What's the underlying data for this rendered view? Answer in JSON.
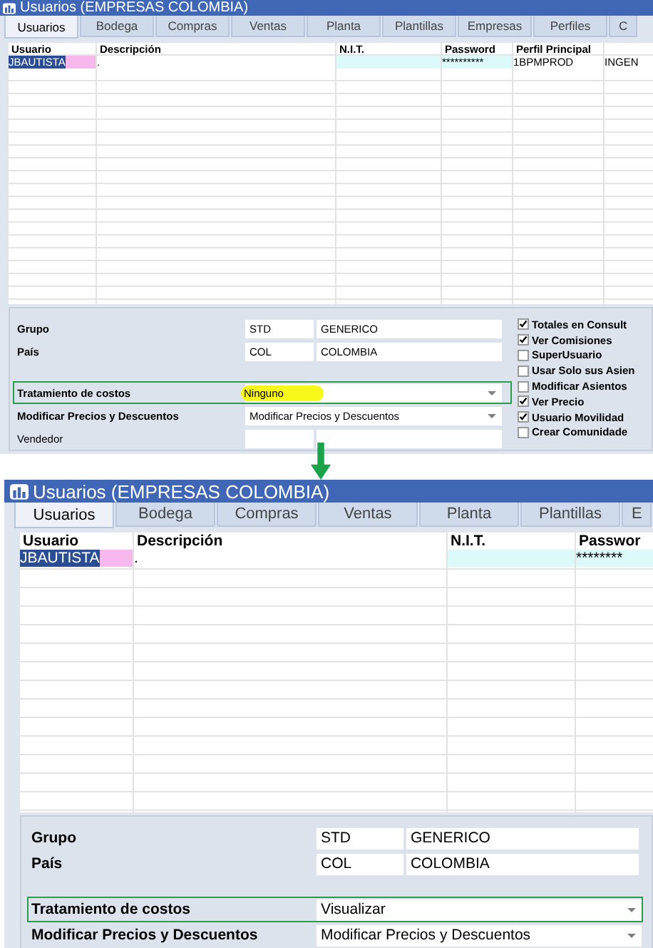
{
  "panels": [
    {
      "title": "Usuarios (EMPRESAS COLOMBIA)",
      "tabs": [
        {
          "label": "Usuarios",
          "selected": true
        },
        {
          "label": "Bodega",
          "selected": false
        },
        {
          "label": "Compras",
          "selected": false
        },
        {
          "label": "Ventas",
          "selected": false
        },
        {
          "label": "Planta",
          "selected": false
        },
        {
          "label": "Plantillas",
          "selected": false
        },
        {
          "label": "Empresas",
          "selected": false
        },
        {
          "label": "Perfiles",
          "selected": false
        },
        {
          "label": "C",
          "selected": false
        }
      ],
      "columns": [
        "Usuario",
        "Descripción",
        "N.I.T.",
        "Password",
        "Perfil Principal",
        null
      ],
      "rows": [
        {
          "selected": true,
          "cells": [
            "JBAUTISTA",
            ".",
            null,
            "**********",
            "1BPMPROD",
            "INGEN"
          ]
        }
      ],
      "form": {
        "field_groups": [
          [
            {
              "label": "Grupo",
              "bold": true,
              "kind": "pair",
              "values": [
                "STD",
                "GENERICO"
              ],
              "framed": false
            },
            {
              "label": "País",
              "bold": true,
              "kind": "pair",
              "values": [
                "COL",
                "COLOMBIA"
              ],
              "framed": false
            }
          ],
          [
            {
              "label": "Tratamiento de costos",
              "bold": true,
              "kind": "select",
              "value": "Ninguno",
              "highlighted": true,
              "framed": true
            },
            {
              "label": "Modificar Precios y Descuentos",
              "bold": true,
              "kind": "select",
              "value": "Modificar Precios y Descuentos",
              "highlighted": false,
              "framed": false
            },
            {
              "label": "Vendedor",
              "bold": false,
              "kind": "pair",
              "framed": false
            }
          ]
        ],
        "checkboxes": [
          {
            "label": "Totales en Consult",
            "checked": true
          },
          {
            "label": "Ver Comisiones",
            "checked": true
          },
          {
            "label": "SuperUsuario",
            "checked": false
          },
          {
            "label": "Usar Solo sus Asien",
            "checked": false
          },
          {
            "label": "Modificar Asientos",
            "checked": false
          },
          {
            "label": "Ver Precio",
            "checked": true
          },
          {
            "label": "Usuario Movilidad",
            "checked": true
          },
          {
            "label": "Crear Comunidade",
            "checked": false
          }
        ]
      }
    },
    {
      "title": "Usuarios (EMPRESAS COLOMBIA)",
      "tabs": [
        {
          "label": "Usuarios",
          "selected": true
        },
        {
          "label": "Bodega",
          "selected": false
        },
        {
          "label": "Compras",
          "selected": false
        },
        {
          "label": "Ventas",
          "selected": false
        },
        {
          "label": "Planta",
          "selected": false
        },
        {
          "label": "Plantillas",
          "selected": false
        },
        {
          "label": "E",
          "selected": false
        }
      ],
      "columns": [
        "Usuario",
        "Descripción",
        "N.I.T.",
        "Passwor"
      ],
      "rows": [
        {
          "selected": true,
          "cells": [
            "JBAUTISTA",
            ".",
            null,
            "********"
          ]
        }
      ],
      "form": {
        "field_groups": [
          [
            {
              "label": "Grupo",
              "bold": true,
              "kind": "pair",
              "values": [
                "STD",
                "GENERICO"
              ],
              "framed": false
            },
            {
              "label": "País",
              "bold": true,
              "kind": "pair",
              "values": [
                "COL",
                "COLOMBIA"
              ],
              "framed": false
            }
          ],
          [
            {
              "label": "Tratamiento de costos",
              "bold": true,
              "kind": "select",
              "value": "Visualizar",
              "highlighted": false,
              "framed": true
            },
            {
              "label": "Modificar Precios y Descuentos",
              "bold": true,
              "kind": "select",
              "value": "Modificar Precios y Descuentos",
              "highlighted": false,
              "framed": false
            }
          ]
        ]
      }
    }
  ]
}
